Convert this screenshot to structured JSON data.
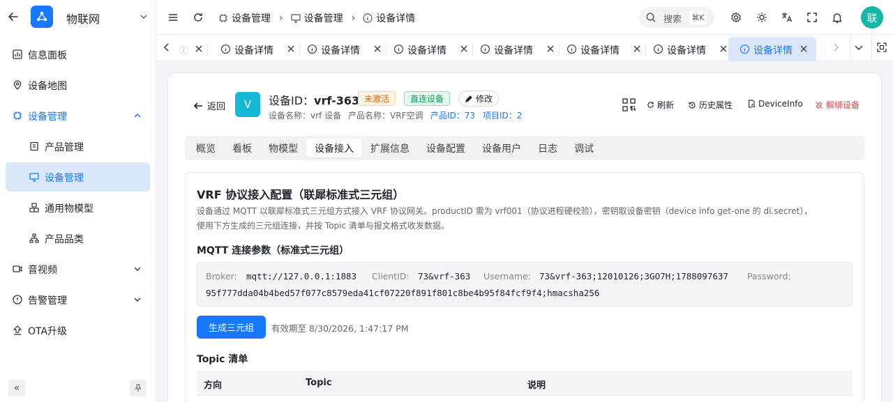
{
  "sidebar": {
    "app_name": "物联网",
    "items": [
      {
        "label": "信息面板"
      },
      {
        "label": "设备地图"
      },
      {
        "label": "设备管理"
      },
      {
        "label": "产品管理"
      },
      {
        "label": "设备管理"
      },
      {
        "label": "通用物模型"
      },
      {
        "label": "产品品类"
      },
      {
        "label": "音视频"
      },
      {
        "label": "告警管理"
      },
      {
        "label": "OTA升级"
      }
    ],
    "collapse_label": "«"
  },
  "header": {
    "breadcrumb": [
      "设备管理",
      "设备管理",
      "设备详情"
    ],
    "search_label": "搜索",
    "search_shortcut": "⌘K",
    "avatar_text": "联"
  },
  "tabs": {
    "items": [
      {
        "label": "设备详情"
      },
      {
        "label": "设备详情"
      },
      {
        "label": "设备详情"
      },
      {
        "label": "设备详情"
      },
      {
        "label": "设备详情"
      },
      {
        "label": "设备详情"
      },
      {
        "label": "设备详情",
        "active": true
      }
    ]
  },
  "device": {
    "back_label": "返回",
    "avatar_letter": "V",
    "title_prefix": "设备ID：",
    "title_id": "vrf-363",
    "badge_status": "未激活",
    "badge_type": "直连设备",
    "edit_label": "修改",
    "device_name": "设备名称：vrf 设备",
    "product_name": "产品名称：VRF空调",
    "product_id": "产品ID：73",
    "project_id": "项目ID：2",
    "actions": {
      "refresh": "刷新",
      "history": "历史属性",
      "device_info": "DeviceInfo",
      "unbind": "解绑设备"
    }
  },
  "subtabs": [
    "概览",
    "看板",
    "物模型",
    "设备接入",
    "扩展信息",
    "设备配置",
    "设备用户",
    "日志",
    "调试"
  ],
  "panel": {
    "title": "VRF 协议接入配置（联犀标准式三元组）",
    "desc_line1": "设备通过 MQTT 以联犀标准式三元组方式接入 VRF 协议网关。productID 需为 vrf001（协议进程硬校验），密钥取设备密钥（device info get-one 的 di.secret），",
    "desc_line2": "使用下方生成的三元组连接，并按 Topic 清单与报文格式收发数据。",
    "mqtt_heading": "MQTT 连接参数（标准式三元组）",
    "broker_label": "Broker:",
    "broker_value": "mqtt://127.0.0.1:1883",
    "client_label": "ClientID:",
    "client_value": "73&vrf-363",
    "user_label": "Username:",
    "user_value": "73&vrf-363;12010126;3GO7H;1788097637",
    "pass_label": "Password:",
    "pass_value": "95f777dda04b4bed57f077c8579eda41cf07220f891f801c8be4b95f84fcf9f4;hmacsha256",
    "gen_button": "生成三元组",
    "valid_text": "有效期至 8/30/2026, 1:47:17 PM",
    "topic_heading": "Topic 清单",
    "table_headers": [
      "方向",
      "Topic",
      "说明"
    ]
  }
}
